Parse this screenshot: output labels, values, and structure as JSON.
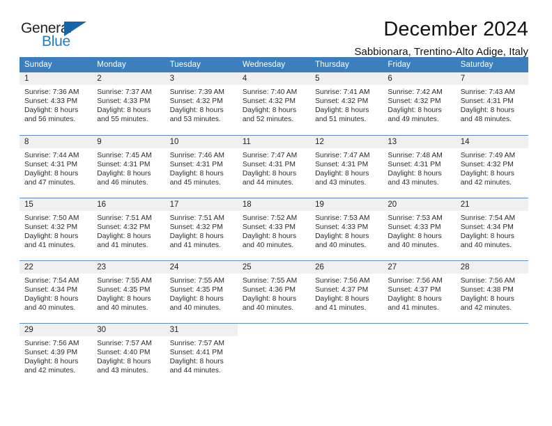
{
  "brand": {
    "word_one": "General",
    "word_two": "Blue",
    "triangle_icon": "triangle-icon",
    "accent_dark": "#231f20",
    "accent_blue": "#1f7ec2",
    "triangle_color": "#1565a8"
  },
  "header": {
    "title": "December 2024",
    "subtitle": "Sabbionara, Trentino-Alto Adige, Italy"
  },
  "calendar": {
    "header_bg": "#3c7fbf",
    "header_text": "#ffffff",
    "daynum_bg": "#f0f0f0",
    "weekday_headers": [
      "Sunday",
      "Monday",
      "Tuesday",
      "Wednesday",
      "Thursday",
      "Friday",
      "Saturday"
    ],
    "weeks": [
      [
        {
          "day": "1",
          "sunrise": "Sunrise: 7:36 AM",
          "sunset": "Sunset: 4:33 PM",
          "daylight_line1": "Daylight: 8 hours",
          "daylight_line2": "and 56 minutes."
        },
        {
          "day": "2",
          "sunrise": "Sunrise: 7:37 AM",
          "sunset": "Sunset: 4:33 PM",
          "daylight_line1": "Daylight: 8 hours",
          "daylight_line2": "and 55 minutes."
        },
        {
          "day": "3",
          "sunrise": "Sunrise: 7:39 AM",
          "sunset": "Sunset: 4:32 PM",
          "daylight_line1": "Daylight: 8 hours",
          "daylight_line2": "and 53 minutes."
        },
        {
          "day": "4",
          "sunrise": "Sunrise: 7:40 AM",
          "sunset": "Sunset: 4:32 PM",
          "daylight_line1": "Daylight: 8 hours",
          "daylight_line2": "and 52 minutes."
        },
        {
          "day": "5",
          "sunrise": "Sunrise: 7:41 AM",
          "sunset": "Sunset: 4:32 PM",
          "daylight_line1": "Daylight: 8 hours",
          "daylight_line2": "and 51 minutes."
        },
        {
          "day": "6",
          "sunrise": "Sunrise: 7:42 AM",
          "sunset": "Sunset: 4:32 PM",
          "daylight_line1": "Daylight: 8 hours",
          "daylight_line2": "and 49 minutes."
        },
        {
          "day": "7",
          "sunrise": "Sunrise: 7:43 AM",
          "sunset": "Sunset: 4:31 PM",
          "daylight_line1": "Daylight: 8 hours",
          "daylight_line2": "and 48 minutes."
        }
      ],
      [
        {
          "day": "8",
          "sunrise": "Sunrise: 7:44 AM",
          "sunset": "Sunset: 4:31 PM",
          "daylight_line1": "Daylight: 8 hours",
          "daylight_line2": "and 47 minutes."
        },
        {
          "day": "9",
          "sunrise": "Sunrise: 7:45 AM",
          "sunset": "Sunset: 4:31 PM",
          "daylight_line1": "Daylight: 8 hours",
          "daylight_line2": "and 46 minutes."
        },
        {
          "day": "10",
          "sunrise": "Sunrise: 7:46 AM",
          "sunset": "Sunset: 4:31 PM",
          "daylight_line1": "Daylight: 8 hours",
          "daylight_line2": "and 45 minutes."
        },
        {
          "day": "11",
          "sunrise": "Sunrise: 7:47 AM",
          "sunset": "Sunset: 4:31 PM",
          "daylight_line1": "Daylight: 8 hours",
          "daylight_line2": "and 44 minutes."
        },
        {
          "day": "12",
          "sunrise": "Sunrise: 7:47 AM",
          "sunset": "Sunset: 4:31 PM",
          "daylight_line1": "Daylight: 8 hours",
          "daylight_line2": "and 43 minutes."
        },
        {
          "day": "13",
          "sunrise": "Sunrise: 7:48 AM",
          "sunset": "Sunset: 4:31 PM",
          "daylight_line1": "Daylight: 8 hours",
          "daylight_line2": "and 43 minutes."
        },
        {
          "day": "14",
          "sunrise": "Sunrise: 7:49 AM",
          "sunset": "Sunset: 4:32 PM",
          "daylight_line1": "Daylight: 8 hours",
          "daylight_line2": "and 42 minutes."
        }
      ],
      [
        {
          "day": "15",
          "sunrise": "Sunrise: 7:50 AM",
          "sunset": "Sunset: 4:32 PM",
          "daylight_line1": "Daylight: 8 hours",
          "daylight_line2": "and 41 minutes."
        },
        {
          "day": "16",
          "sunrise": "Sunrise: 7:51 AM",
          "sunset": "Sunset: 4:32 PM",
          "daylight_line1": "Daylight: 8 hours",
          "daylight_line2": "and 41 minutes."
        },
        {
          "day": "17",
          "sunrise": "Sunrise: 7:51 AM",
          "sunset": "Sunset: 4:32 PM",
          "daylight_line1": "Daylight: 8 hours",
          "daylight_line2": "and 41 minutes."
        },
        {
          "day": "18",
          "sunrise": "Sunrise: 7:52 AM",
          "sunset": "Sunset: 4:33 PM",
          "daylight_line1": "Daylight: 8 hours",
          "daylight_line2": "and 40 minutes."
        },
        {
          "day": "19",
          "sunrise": "Sunrise: 7:53 AM",
          "sunset": "Sunset: 4:33 PM",
          "daylight_line1": "Daylight: 8 hours",
          "daylight_line2": "and 40 minutes."
        },
        {
          "day": "20",
          "sunrise": "Sunrise: 7:53 AM",
          "sunset": "Sunset: 4:33 PM",
          "daylight_line1": "Daylight: 8 hours",
          "daylight_line2": "and 40 minutes."
        },
        {
          "day": "21",
          "sunrise": "Sunrise: 7:54 AM",
          "sunset": "Sunset: 4:34 PM",
          "daylight_line1": "Daylight: 8 hours",
          "daylight_line2": "and 40 minutes."
        }
      ],
      [
        {
          "day": "22",
          "sunrise": "Sunrise: 7:54 AM",
          "sunset": "Sunset: 4:34 PM",
          "daylight_line1": "Daylight: 8 hours",
          "daylight_line2": "and 40 minutes."
        },
        {
          "day": "23",
          "sunrise": "Sunrise: 7:55 AM",
          "sunset": "Sunset: 4:35 PM",
          "daylight_line1": "Daylight: 8 hours",
          "daylight_line2": "and 40 minutes."
        },
        {
          "day": "24",
          "sunrise": "Sunrise: 7:55 AM",
          "sunset": "Sunset: 4:35 PM",
          "daylight_line1": "Daylight: 8 hours",
          "daylight_line2": "and 40 minutes."
        },
        {
          "day": "25",
          "sunrise": "Sunrise: 7:55 AM",
          "sunset": "Sunset: 4:36 PM",
          "daylight_line1": "Daylight: 8 hours",
          "daylight_line2": "and 40 minutes."
        },
        {
          "day": "26",
          "sunrise": "Sunrise: 7:56 AM",
          "sunset": "Sunset: 4:37 PM",
          "daylight_line1": "Daylight: 8 hours",
          "daylight_line2": "and 41 minutes."
        },
        {
          "day": "27",
          "sunrise": "Sunrise: 7:56 AM",
          "sunset": "Sunset: 4:37 PM",
          "daylight_line1": "Daylight: 8 hours",
          "daylight_line2": "and 41 minutes."
        },
        {
          "day": "28",
          "sunrise": "Sunrise: 7:56 AM",
          "sunset": "Sunset: 4:38 PM",
          "daylight_line1": "Daylight: 8 hours",
          "daylight_line2": "and 42 minutes."
        }
      ],
      [
        {
          "day": "29",
          "sunrise": "Sunrise: 7:56 AM",
          "sunset": "Sunset: 4:39 PM",
          "daylight_line1": "Daylight: 8 hours",
          "daylight_line2": "and 42 minutes."
        },
        {
          "day": "30",
          "sunrise": "Sunrise: 7:57 AM",
          "sunset": "Sunset: 4:40 PM",
          "daylight_line1": "Daylight: 8 hours",
          "daylight_line2": "and 43 minutes."
        },
        {
          "day": "31",
          "sunrise": "Sunrise: 7:57 AM",
          "sunset": "Sunset: 4:41 PM",
          "daylight_line1": "Daylight: 8 hours",
          "daylight_line2": "and 44 minutes."
        },
        {
          "day": "",
          "sunrise": "",
          "sunset": "",
          "daylight_line1": "",
          "daylight_line2": ""
        },
        {
          "day": "",
          "sunrise": "",
          "sunset": "",
          "daylight_line1": "",
          "daylight_line2": ""
        },
        {
          "day": "",
          "sunrise": "",
          "sunset": "",
          "daylight_line1": "",
          "daylight_line2": ""
        },
        {
          "day": "",
          "sunrise": "",
          "sunset": "",
          "daylight_line1": "",
          "daylight_line2": ""
        }
      ]
    ]
  }
}
